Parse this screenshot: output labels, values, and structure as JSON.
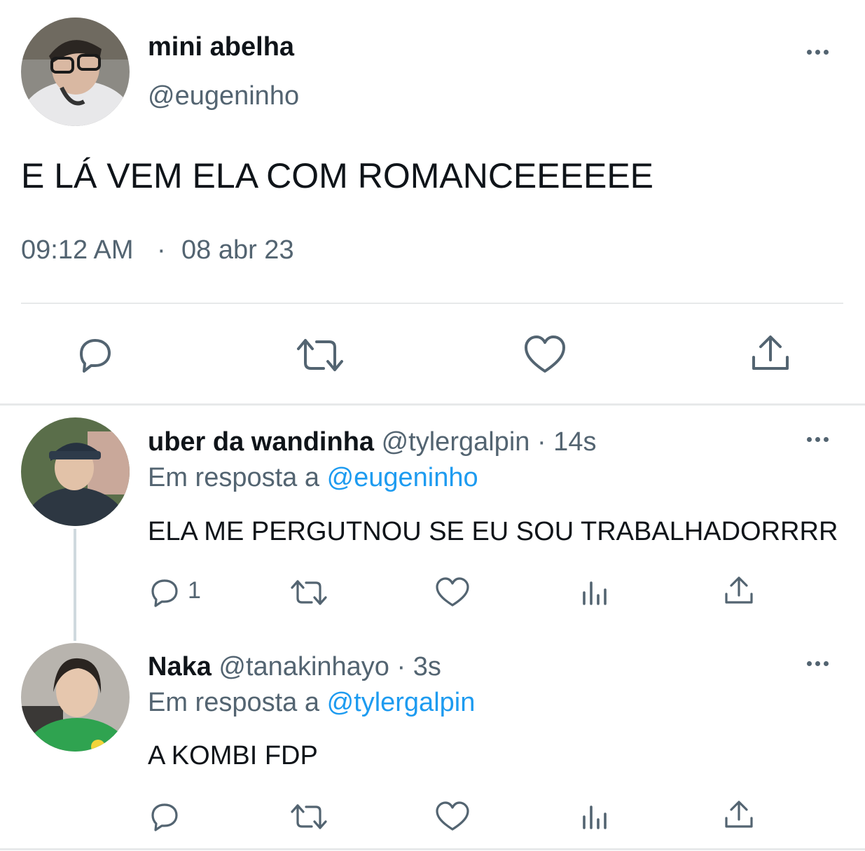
{
  "main_tweet": {
    "display_name": "mini abelha",
    "handle": "@eugeninho",
    "text": "E LÁ VEM ELA COM ROMANCEEEEEE",
    "time": "09:12 AM",
    "separator": "·",
    "date": "08 abr 23",
    "actions": [
      "reply-icon",
      "retweet-icon",
      "like-icon",
      "share-icon"
    ]
  },
  "replies": [
    {
      "display_name": "uber da wandinha",
      "handle": "@tylergalpin",
      "age": "· 14s",
      "reply_prefix": "Em resposta a",
      "reply_to": "@eugeninho",
      "text": "ELA ME PERGUTNOU SE EU SOU TRABALHADORRRR",
      "reply_count": "1"
    },
    {
      "display_name": "Naka",
      "handle": "@tanakinhayo",
      "age": "· 3s",
      "reply_prefix": "Em resposta a",
      "reply_to": "@tylergalpin",
      "text": "A KOMBI FDP",
      "reply_count": ""
    }
  ],
  "colors": {
    "text": "#0f1419",
    "muted": "#536471",
    "link": "#1d9bf0",
    "divider": "#e7e9ea"
  }
}
